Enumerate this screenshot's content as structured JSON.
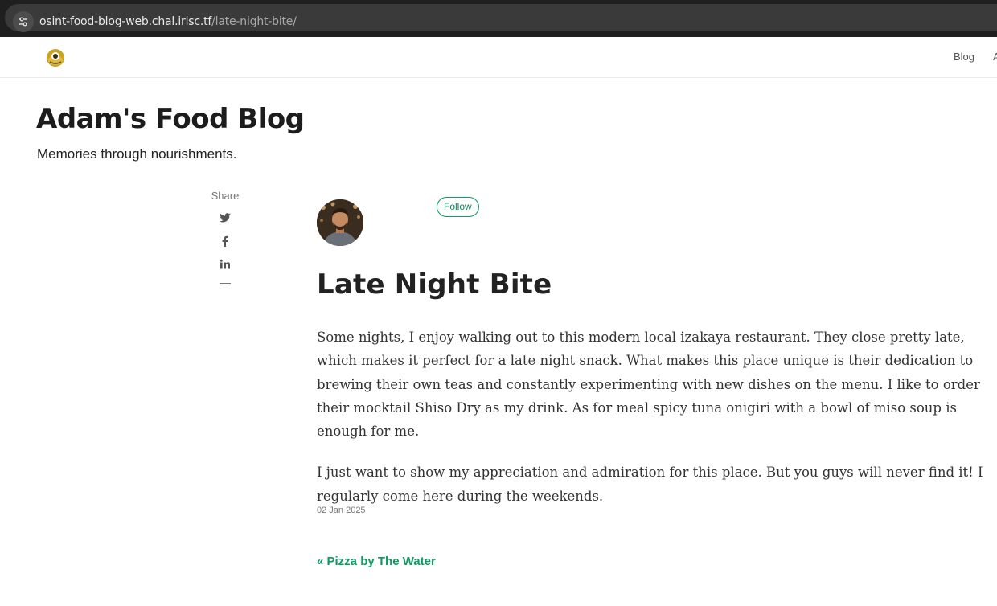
{
  "browser": {
    "url_host": "osint-food-blog-web.chal.irisc.tf",
    "url_path": "/late-night-bite/"
  },
  "nav": {
    "blog_label": "Blog",
    "about_label": "A"
  },
  "header": {
    "title": "Adam's Food Blog",
    "tagline": "Memories through nourishments."
  },
  "share": {
    "label": "Share",
    "icons": [
      "twitter-icon",
      "facebook-icon",
      "linkedin-icon"
    ]
  },
  "author": {
    "follow_label": "Follow"
  },
  "post": {
    "title": "Late Night Bite",
    "paragraphs": [
      "Some nights, I enjoy walking out to this modern local izakaya restaurant. They close pretty late, which makes it perfect for a late night snack. What makes this place unique is their dedication to brewing their own teas and constantly experimenting with new dishes on the menu. I like to order their mocktail Shiso Dry as my drink. As for meal spicy tuna onigiri with a bowl of miso soup is enough for me.",
      "I just want to show my appreciation and admiration for this place. But you guys will never find it! I regularly come here during the weekends."
    ],
    "date": "02 Jan 2025",
    "prev_link": "« Pizza by The Water"
  },
  "colors": {
    "accent": "#0c9b61",
    "browser_bar": "#1f1f1f",
    "url_field": "#3a3a3a"
  }
}
